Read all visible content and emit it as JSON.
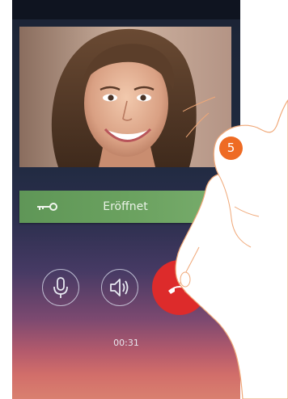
{
  "door": {
    "label": "Eröffnet"
  },
  "call": {
    "timer": "00:31"
  },
  "annotation": {
    "step_number": "5"
  },
  "icons": {
    "door": "key-icon",
    "microphone": "microphone-icon",
    "speaker": "speaker-icon",
    "end_call": "hang-up-icon"
  },
  "colors": {
    "door_bar": "#6aa15f",
    "end_call": "#dd2b2b",
    "step_badge": "#ee6b24"
  }
}
